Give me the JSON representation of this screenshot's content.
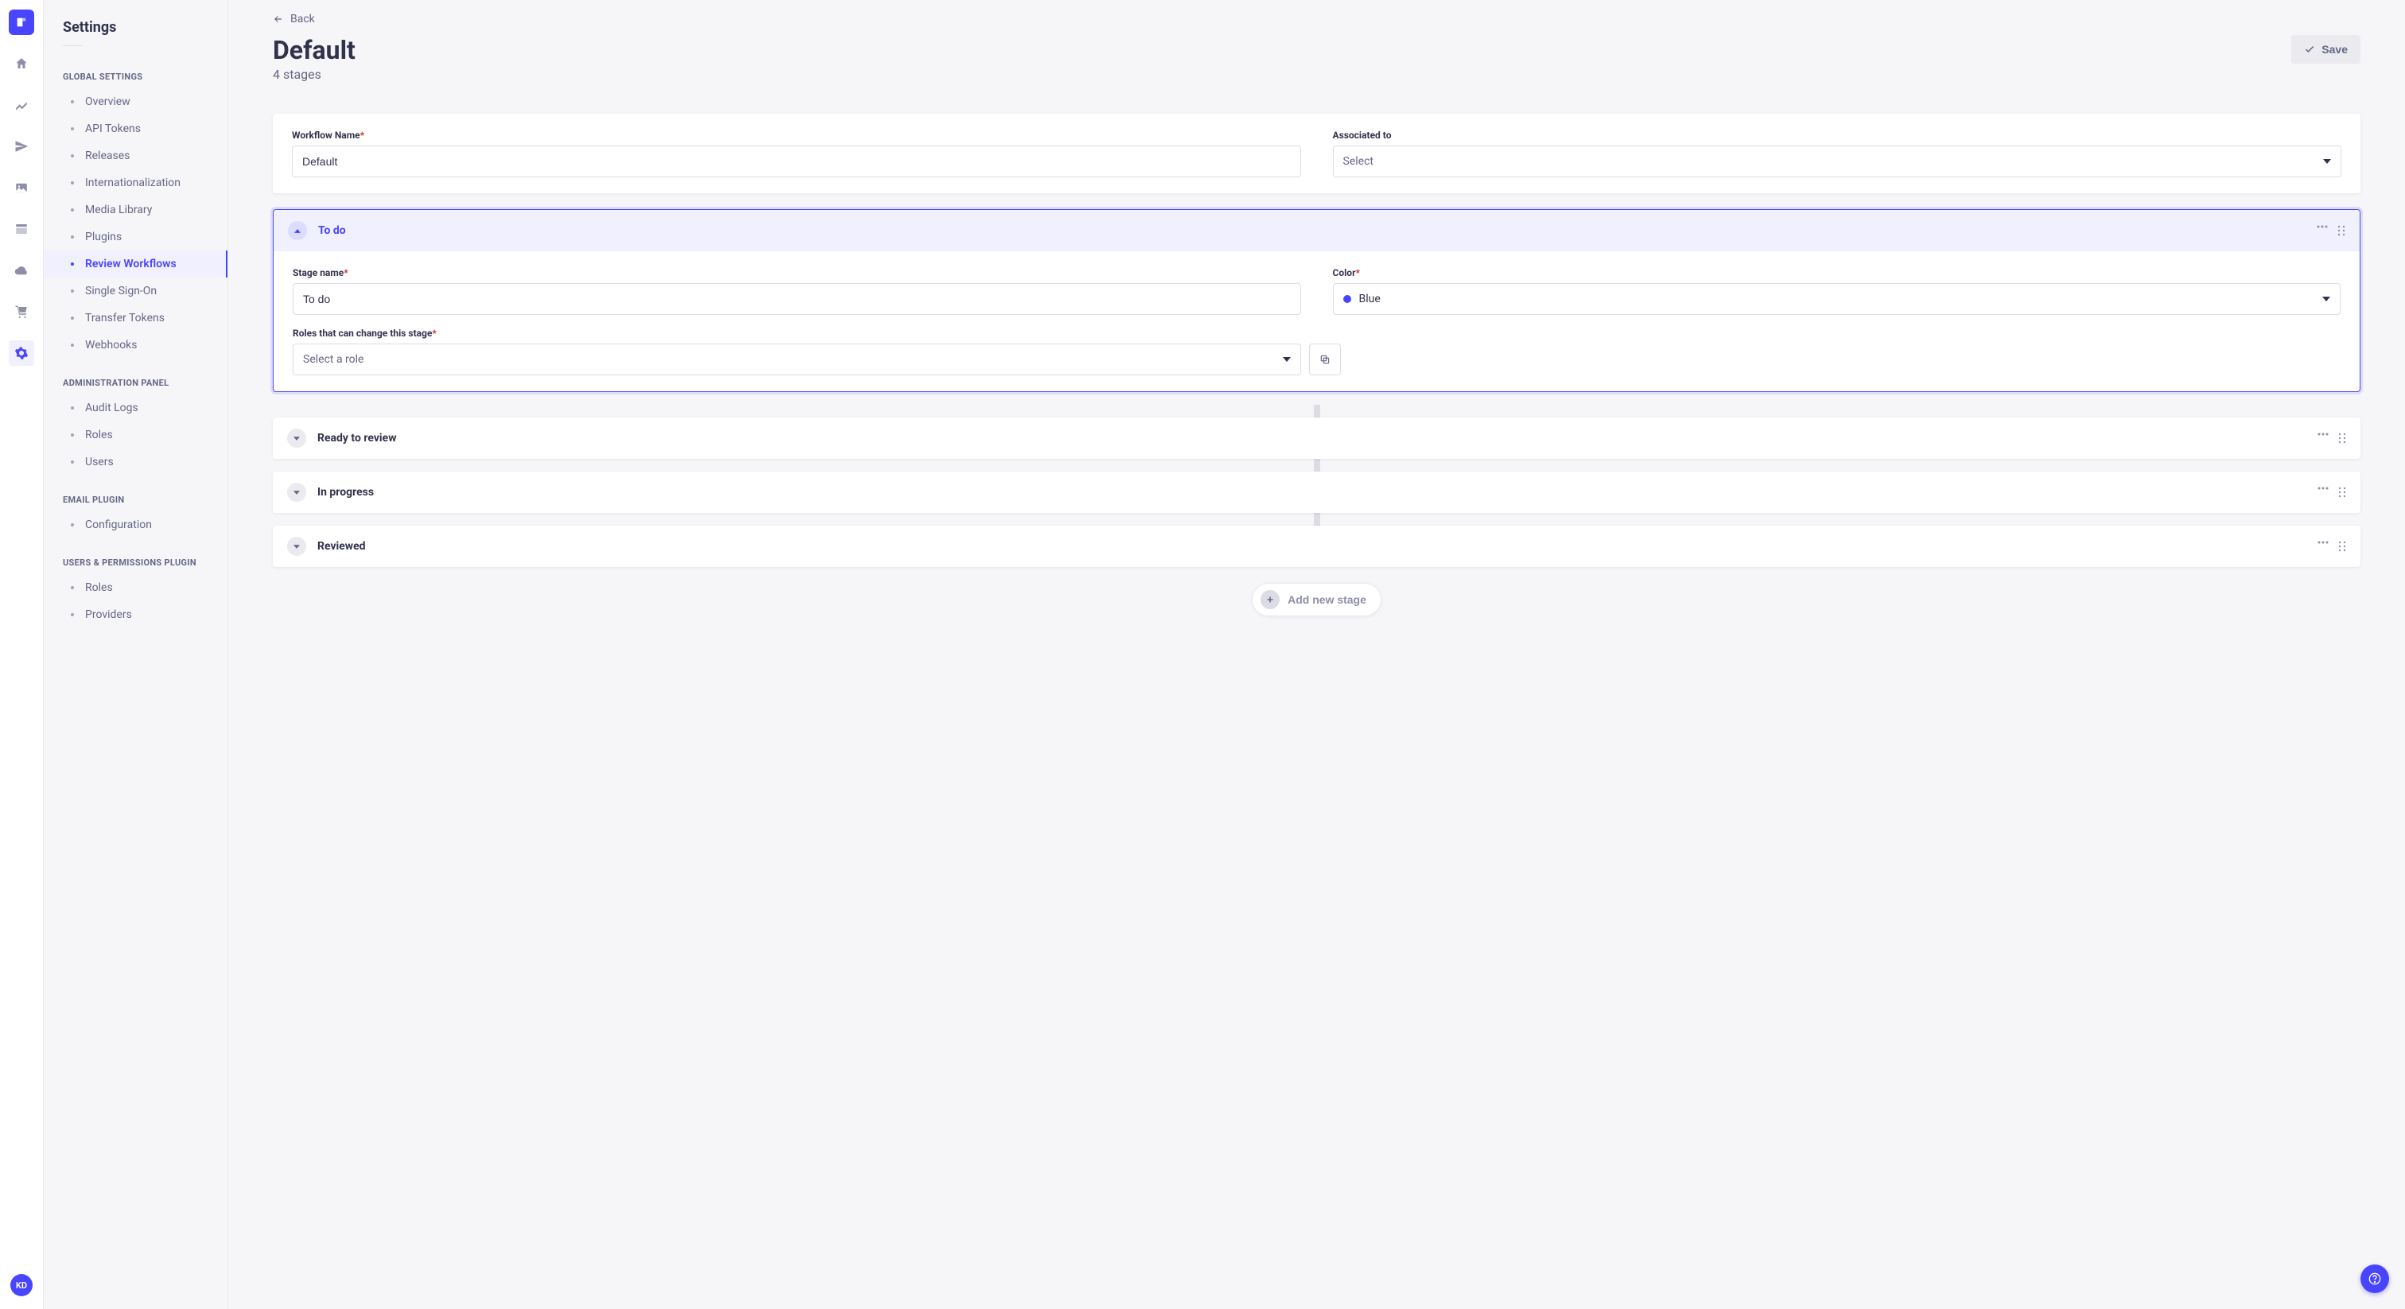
{
  "sidebar": {
    "title": "Settings",
    "sections": [
      {
        "label": "GLOBAL SETTINGS",
        "items": [
          "Overview",
          "API Tokens",
          "Releases",
          "Internationalization",
          "Media Library",
          "Plugins",
          "Review Workflows",
          "Single Sign-On",
          "Transfer Tokens",
          "Webhooks"
        ],
        "active_index": 6
      },
      {
        "label": "ADMINISTRATION PANEL",
        "items": [
          "Audit Logs",
          "Roles",
          "Users"
        ],
        "active_index": -1
      },
      {
        "label": "EMAIL PLUGIN",
        "items": [
          "Configuration"
        ],
        "active_index": -1
      },
      {
        "label": "USERS & PERMISSIONS PLUGIN",
        "items": [
          "Roles",
          "Providers"
        ],
        "active_index": -1
      }
    ]
  },
  "avatar": "KD",
  "header": {
    "back": "Back",
    "title": "Default",
    "subtitle": "4 stages",
    "save": "Save"
  },
  "workflow_form": {
    "name_label": "Workflow Name",
    "name_value": "Default",
    "associated_label": "Associated to",
    "associated_placeholder": "Select"
  },
  "expanded_stage": {
    "title": "To do",
    "stage_name_label": "Stage name",
    "stage_name_value": "To do",
    "color_label": "Color",
    "color_value": "Blue",
    "color_hex": "#4945ff",
    "roles_label": "Roles that can change this stage",
    "roles_placeholder": "Select a role"
  },
  "collapsed_stages": [
    {
      "title": "Ready to review"
    },
    {
      "title": "In progress"
    },
    {
      "title": "Reviewed"
    }
  ],
  "add_stage": "Add new stage"
}
